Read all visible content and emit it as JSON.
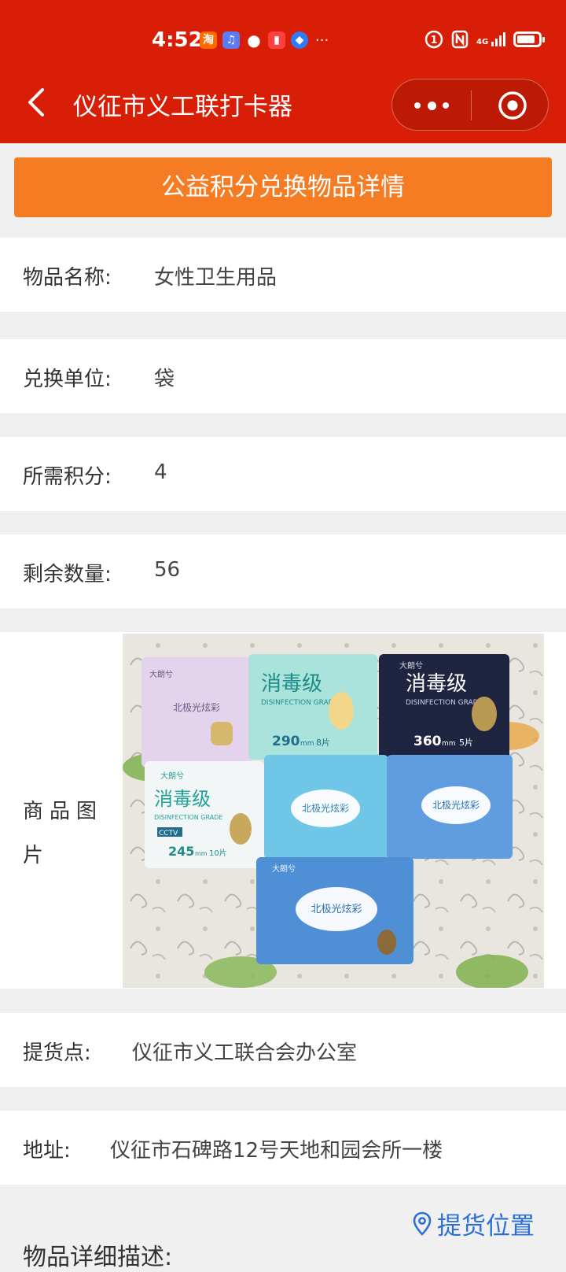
{
  "status_bar": {
    "time": "4:52",
    "network": "4G",
    "ellipsis": "···"
  },
  "nav": {
    "title": "仪征市义工联打卡器"
  },
  "banner": {
    "text": "公益积分兑换物品详情"
  },
  "fields": [
    {
      "label": "物品名称:",
      "value": "女性卫生用品"
    },
    {
      "label": "兑换单位:",
      "value": "袋"
    },
    {
      "label": "所需积分:",
      "value": "4"
    },
    {
      "label": "剩余数量:",
      "value": "56"
    }
  ],
  "image_section": {
    "label": "商品图片"
  },
  "product_photo": {
    "packs": [
      {
        "brand": "大朗兮",
        "title": "北极光炫彩",
        "color": "#d9c5e6"
      },
      {
        "brand": "",
        "title": "消毒级",
        "sub": "DISINFECTION GRADE",
        "size": "290",
        "unit": "mm",
        "count": "8片",
        "color": "#a9e3dc"
      },
      {
        "brand": "大朗兮",
        "title": "消毒级",
        "sub": "DISINFECTION GRADE",
        "size": "360",
        "unit": "mm",
        "count": "5片",
        "color": "#1f2440"
      },
      {
        "brand": "大朗兮",
        "title": "消毒级",
        "sub": "DISINFECTION GRADE",
        "size": "245",
        "unit": "mm",
        "count": "10片",
        "extra": "CCTV",
        "color": "#f3f6f6"
      },
      {
        "brand": "",
        "title": "北极光炫彩",
        "color": "#6fc6e6"
      },
      {
        "brand": "",
        "title": "北极光炫彩",
        "color": "#5f9de0"
      },
      {
        "brand": "大朗兮",
        "title": "北极光炫彩",
        "color": "#4f8fd6"
      }
    ]
  },
  "pickup_point": {
    "label": "提货点:",
    "value": "仪征市义工联合会办公室"
  },
  "address": {
    "label": "地址:",
    "value": "仪征市石碑路12号天地和园会所一楼"
  },
  "pickup_location_link": {
    "text": "提货位置"
  },
  "detail": {
    "title": "物品详细描述:"
  },
  "colors": {
    "header": "#d81e06",
    "banner": "#f57c23",
    "link": "#2a6fdb"
  }
}
